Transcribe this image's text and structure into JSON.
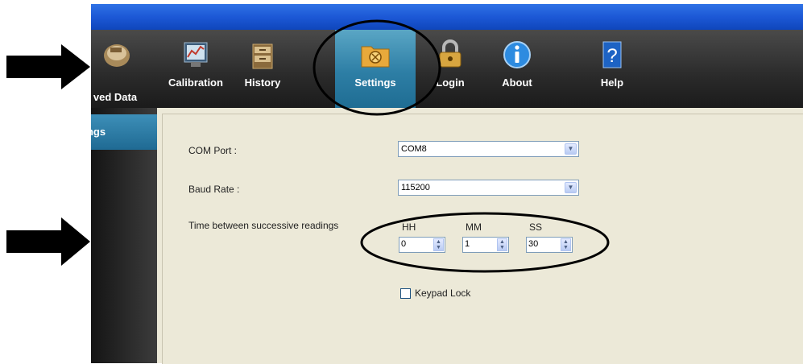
{
  "toolbar": {
    "items": [
      {
        "label": "ved Data",
        "icon": "saved-data-icon"
      },
      {
        "label": "Calibration",
        "icon": "calibration-icon"
      },
      {
        "label": "History",
        "icon": "history-icon"
      },
      {
        "label": "Settings",
        "icon": "settings-folder-icon"
      },
      {
        "label": "Login",
        "icon": "login-lock-icon"
      },
      {
        "label": "About",
        "icon": "about-info-icon"
      },
      {
        "label": "Help",
        "icon": "help-book-icon"
      }
    ],
    "active": "Settings"
  },
  "sidebar": {
    "selected_label": "tings"
  },
  "form": {
    "com_port": {
      "label": "COM Port :",
      "value": "COM8"
    },
    "baud_rate": {
      "label": "Baud Rate :",
      "value": "115200"
    },
    "interval": {
      "label": "Time between successive readings",
      "hh": {
        "label": "HH",
        "value": "0"
      },
      "mm": {
        "label": "MM",
        "value": "1"
      },
      "ss": {
        "label": "SS",
        "value": "30"
      }
    },
    "keypad_lock": {
      "label": "Keypad Lock",
      "checked": false
    }
  },
  "colors": {
    "titlebar": "#1c58d6",
    "toolbar": "#2a2a2a",
    "active_tab": "#2d7ea5",
    "panel": "#ece9d8"
  }
}
